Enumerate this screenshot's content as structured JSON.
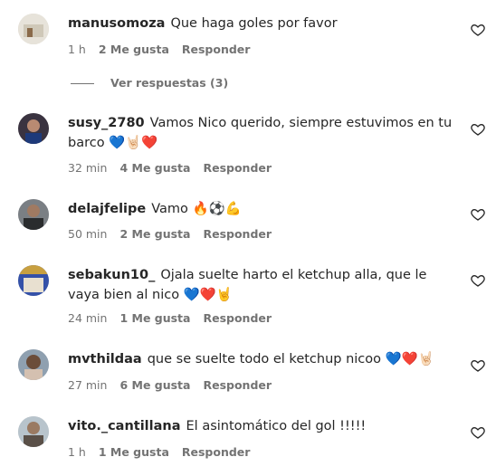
{
  "comments": [
    {
      "user": "manusomoza",
      "text": "Que haga goles por favor",
      "time": "1 h",
      "likes": "2 Me gusta",
      "reply": "Responder",
      "avatar_color": "#d8d3c8"
    },
    {
      "user": "susy_2780",
      "text": "Vamos Nico querido, siempre estuvimos en tu barco 💙🤘🏻❤️",
      "time": "32 min",
      "likes": "4 Me gusta",
      "reply": "Responder",
      "avatar_color": "#3a3340"
    },
    {
      "user": "delajfelipe",
      "text": "Vamo 🔥⚽💪",
      "time": "50 min",
      "likes": "2 Me gusta",
      "reply": "Responder",
      "avatar_color": "#5b5f63"
    },
    {
      "user": "sebakun10_",
      "text": "Ojala suelte harto el ketchup alla, que le vaya bien al nico 💙❤️🤘",
      "time": "24 min",
      "likes": "1 Me gusta",
      "reply": "Responder",
      "avatar_color": "#3451a8"
    },
    {
      "user": "mvthildaa",
      "text": "que se suelte todo el ketchup nicoo 💙❤️🤘🏻",
      "time": "27 min",
      "likes": "6 Me gusta",
      "reply": "Responder",
      "avatar_color": "#6b4d3a"
    },
    {
      "user": "vito._cantillana",
      "text": "El asintomático del gol !!!!!",
      "time": "1 h",
      "likes": "1 Me gusta",
      "reply": "Responder",
      "avatar_color": "#8a7a6a"
    }
  ],
  "view_replies": "Ver respuestas (3)",
  "colors": {
    "text": "#262626",
    "muted": "#737373"
  }
}
